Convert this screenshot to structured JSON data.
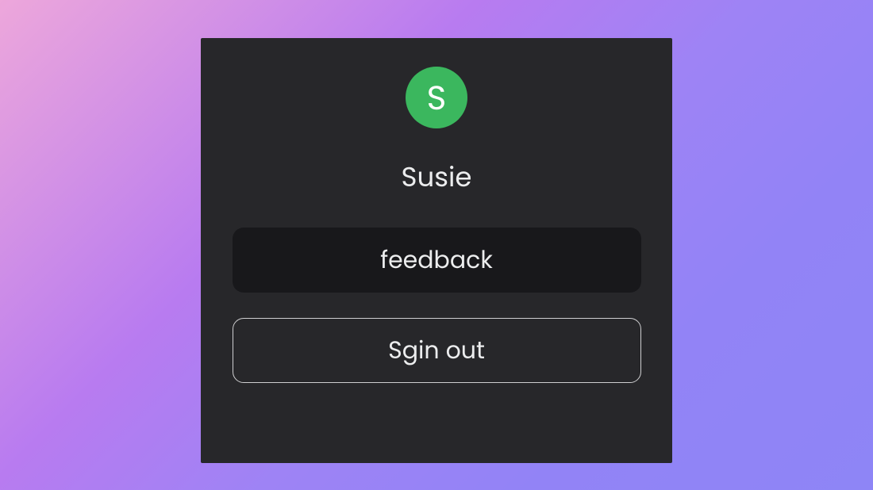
{
  "avatar": {
    "initial": "S",
    "bg_color": "#3BB75E"
  },
  "username": "Susie",
  "buttons": {
    "feedback_label": "feedback",
    "signout_label": "Sgin out"
  }
}
